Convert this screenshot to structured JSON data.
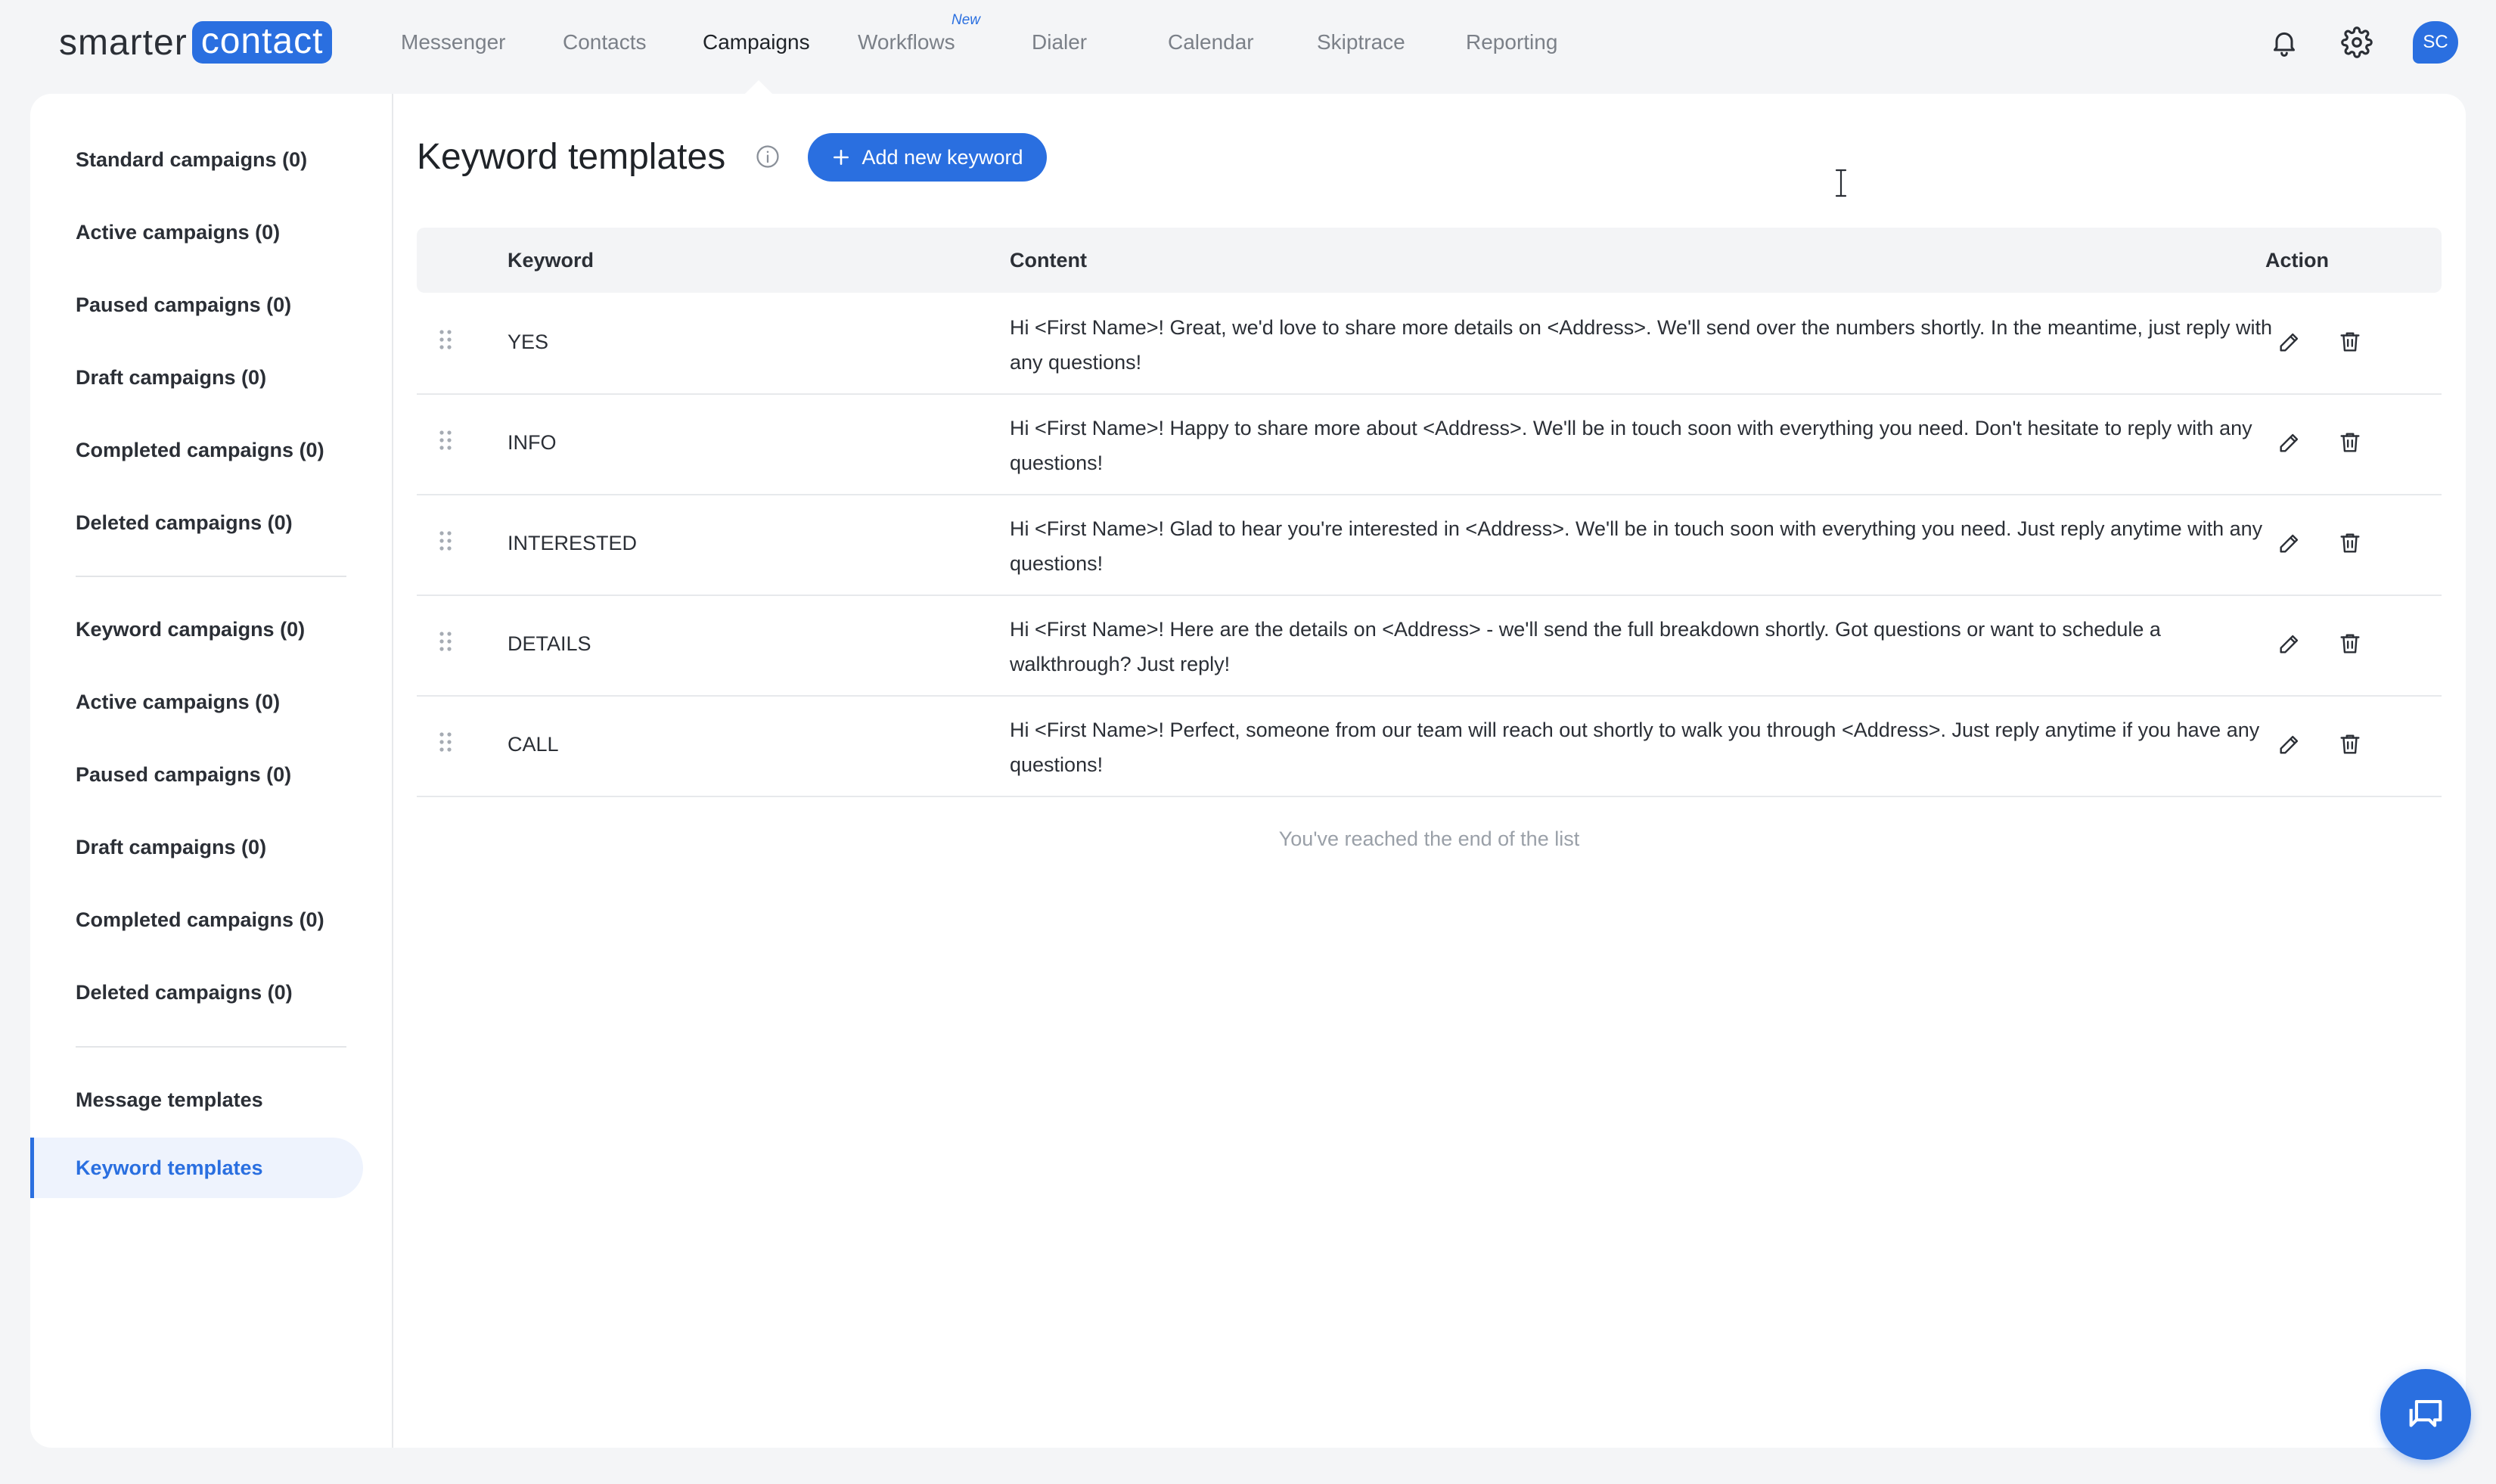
{
  "logo": {
    "left_text": "smarter",
    "box_text": "contact"
  },
  "nav": {
    "items": [
      {
        "label": "Messenger"
      },
      {
        "label": "Contacts"
      },
      {
        "label": "Campaigns",
        "active": true
      },
      {
        "label": "Workflows",
        "badge": "New"
      },
      {
        "label": "Dialer"
      },
      {
        "label": "Calendar"
      },
      {
        "label": "Skiptrace"
      },
      {
        "label": "Reporting"
      }
    ],
    "icons": [
      "bell-icon",
      "gear-icon"
    ],
    "avatar": "SC"
  },
  "sidebar": {
    "groups": [
      [
        "Standard campaigns (0)",
        "Active campaigns (0)",
        "Paused campaigns (0)",
        "Draft campaigns (0)",
        "Completed campaigns (0)",
        "Deleted campaigns (0)"
      ],
      [
        "Keyword campaigns (0)",
        "Active campaigns (0)",
        "Paused campaigns (0)",
        "Draft campaigns (0)",
        "Completed campaigns (0)",
        "Deleted campaigns (0)"
      ],
      [
        "Message templates",
        "Keyword templates"
      ]
    ],
    "selected": "Keyword templates"
  },
  "page": {
    "title": "Keyword templates",
    "add_button": "Add new keyword"
  },
  "table": {
    "headers": {
      "keyword": "Keyword",
      "content": "Content",
      "action": "Action"
    },
    "rows": [
      {
        "keyword": "YES",
        "content": "Hi <First Name>! Great, we'd love to share more details on <Address>. We'll send over the numbers shortly. In the meantime, just reply with any questions!"
      },
      {
        "keyword": "INFO",
        "content": "Hi <First Name>! Happy to share more about <Address>. We'll be in touch soon with everything you need. Don't hesitate to reply with any questions!"
      },
      {
        "keyword": "INTERESTED",
        "content": "Hi <First Name>! Glad to hear you're interested in <Address>. We'll be in touch soon with everything you need. Just reply anytime with any questions!"
      },
      {
        "keyword": "DETAILS",
        "content": "Hi <First Name>! Here are the details on <Address> - we'll send the full breakdown shortly. Got questions or want to schedule a walkthrough? Just reply!"
      },
      {
        "keyword": "CALL",
        "content": "Hi <First Name>! Perfect, someone from our team will reach out shortly to walk you through <Address>. Just reply anytime if you have any questions!"
      }
    ],
    "end_note": "You've reached the end of the list"
  },
  "colors": {
    "accent": "#2a6fe0",
    "selected_bg": "#eef3fd"
  }
}
